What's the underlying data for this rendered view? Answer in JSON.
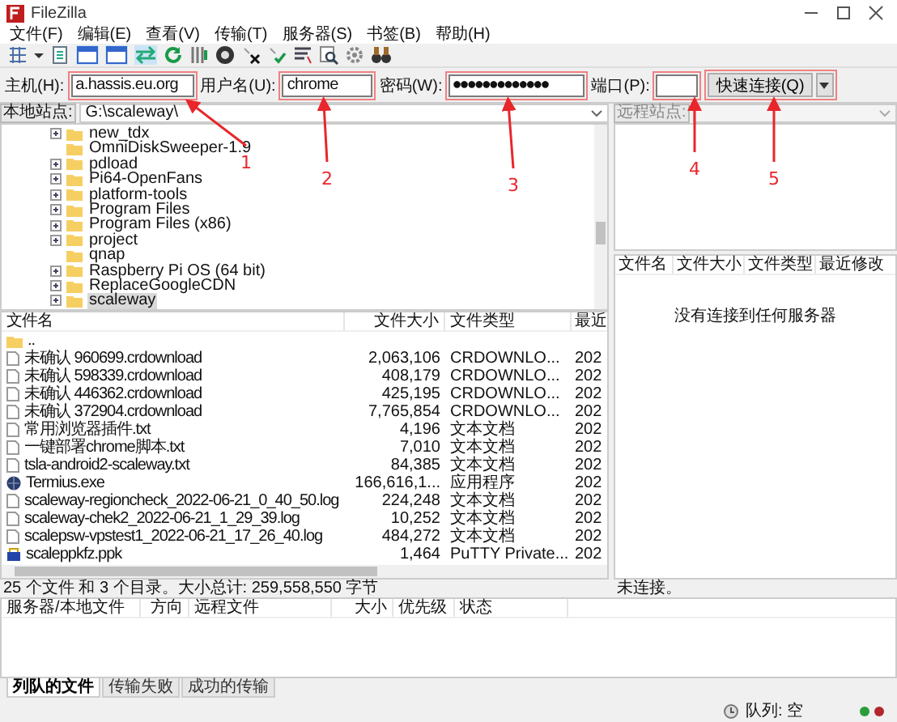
{
  "window": {
    "title": "FileZilla"
  },
  "menu": [
    "文件(F)",
    "编辑(E)",
    "查看(V)",
    "传输(T)",
    "服务器(S)",
    "书签(B)",
    "帮助(H)"
  ],
  "quickconnect": {
    "fields": [
      {
        "label": "主机(H):",
        "value": "a.hassis.eu.org"
      },
      {
        "label": "用户名(U):",
        "value": "chrome"
      },
      {
        "label": "密码(W):",
        "value": "●●●●●●●●●●●●●"
      },
      {
        "label": "端口(P):"
      }
    ],
    "button": "快速连接(Q)"
  },
  "local": {
    "site_label": "本地站点:",
    "path": "G:\\scaleway\\",
    "tree": [
      {
        "name": "new_tdx",
        "expandable": true,
        "selected": false
      },
      {
        "name": "OmniDiskSweeper-1.9",
        "expandable": false,
        "selected": false
      },
      {
        "name": "pdload",
        "expandable": true,
        "selected": false
      },
      {
        "name": "Pi64-OpenFans",
        "expandable": true,
        "selected": false
      },
      {
        "name": "platform-tools",
        "expandable": true,
        "selected": false
      },
      {
        "name": "Program Files",
        "expandable": true,
        "selected": false
      },
      {
        "name": "Program Files (x86)",
        "expandable": true,
        "selected": false
      },
      {
        "name": "project",
        "expandable": true,
        "selected": false
      },
      {
        "name": "qnap",
        "expandable": false,
        "selected": false
      },
      {
        "name": "Raspberry Pi OS (64 bit)",
        "expandable": true,
        "selected": false
      },
      {
        "name": "ReplaceGoogleCDN",
        "expandable": true,
        "selected": false
      },
      {
        "name": "scaleway",
        "expandable": true,
        "selected": true
      }
    ],
    "columns": [
      "文件名",
      "文件大小",
      "文件类型",
      "最近"
    ],
    "files": [
      {
        "kind": "folder",
        "name": ".."
      },
      {
        "kind": "file",
        "name": "未确认 960699.crdownload",
        "size": "2,063,106",
        "type": "CRDOWNLO...",
        "date": "202"
      },
      {
        "kind": "file",
        "name": "未确认 598339.crdownload",
        "size": "408,179",
        "type": "CRDOWNLO...",
        "date": "202"
      },
      {
        "kind": "file",
        "name": "未确认 446362.crdownload",
        "size": "425,195",
        "type": "CRDOWNLO...",
        "date": "202"
      },
      {
        "kind": "file",
        "name": "未确认 372904.crdownload",
        "size": "7,765,854",
        "type": "CRDOWNLO...",
        "date": "202"
      },
      {
        "kind": "file",
        "name": "常用浏览器插件.txt",
        "size": "4,196",
        "type": "文本文档",
        "date": "202"
      },
      {
        "kind": "file",
        "name": "一键部署chrome脚本.txt",
        "size": "7,010",
        "type": "文本文档",
        "date": "202"
      },
      {
        "kind": "file",
        "name": "tsla-android2-scaleway.txt",
        "size": "84,385",
        "type": "文本文档",
        "date": "202"
      },
      {
        "kind": "exe",
        "name": "Termius.exe",
        "size": "166,616,1...",
        "type": "应用程序",
        "date": "202"
      },
      {
        "kind": "file",
        "name": "scaleway-regioncheck_2022-06-21_0_40_50.log",
        "size": "224,248",
        "type": "文本文档",
        "date": "202"
      },
      {
        "kind": "file",
        "name": "scaleway-chek2_2022-06-21_1_29_39.log",
        "size": "10,252",
        "type": "文本文档",
        "date": "202"
      },
      {
        "kind": "file",
        "name": "scalepsw-vpstest1_2022-06-21_17_26_40.log",
        "size": "484,272",
        "type": "文本文档",
        "date": "202"
      },
      {
        "kind": "key",
        "name": "scaleppkfz.ppk",
        "size": "1,464",
        "type": "PuTTY Private...",
        "date": "202"
      }
    ],
    "status": "25 个文件 和 3 个目录。大小总计: 259,558,550 字节"
  },
  "remote": {
    "site_label": "远程站点:",
    "site_disabled": true,
    "columns": [
      "文件名",
      "文件大小",
      "文件类型",
      "最近修改"
    ],
    "message": "没有连接到任何服务器",
    "status": "未连接。"
  },
  "queue": {
    "columns": [
      "服务器/本地文件",
      "方向",
      "远程文件",
      "大小",
      "优先级",
      "状态"
    ]
  },
  "queue_tabs": [
    {
      "label": "列队的文件",
      "selected": true
    },
    {
      "label": "传输失败",
      "selected": false
    },
    {
      "label": "成功的传输",
      "selected": false
    }
  ],
  "status_bar": {
    "queue": "队列: 空"
  },
  "annotations": [
    {
      "label": "1"
    },
    {
      "label": "2"
    },
    {
      "label": "3"
    },
    {
      "label": "4"
    },
    {
      "label": "5"
    }
  ]
}
